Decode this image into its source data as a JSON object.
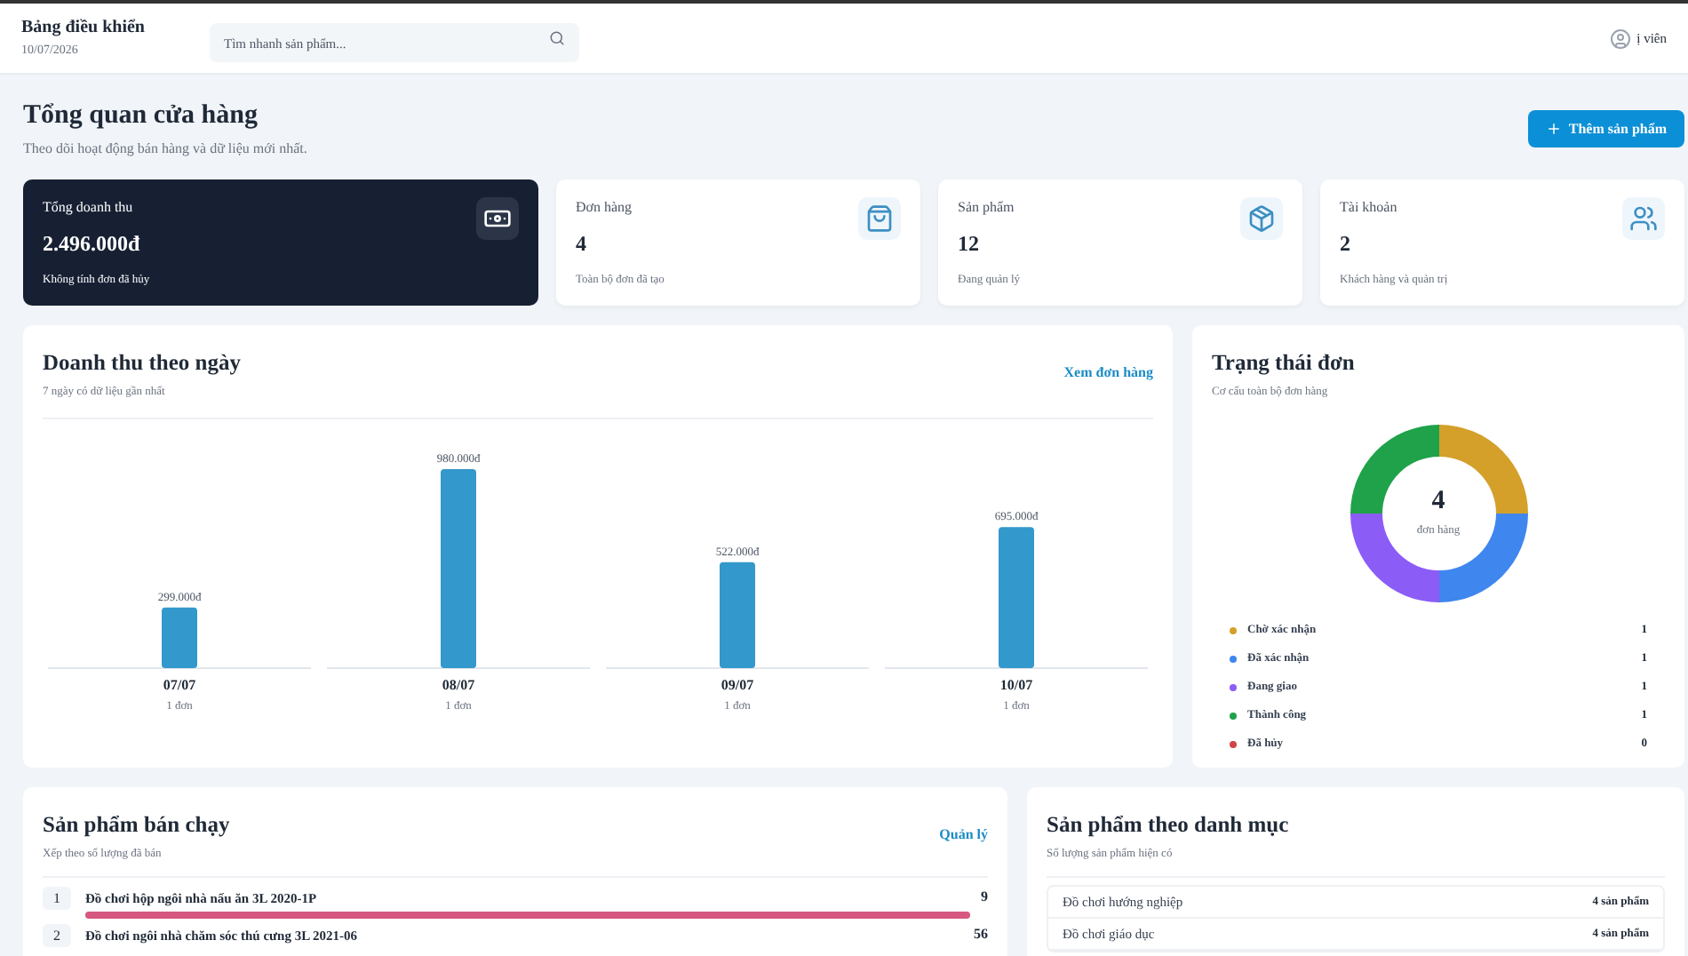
{
  "header": {
    "title": "Bảng điều khiển",
    "date": "10/07/2026",
    "search": {
      "placeholder": "Tìm nhanh sản phẩm..."
    },
    "user_label": "ị viên"
  },
  "overview": {
    "title": "Tổng quan cửa hàng",
    "subtitle": "Theo dõi hoạt động bán hàng và dữ liệu mới nhất.",
    "add_button": "Thêm sản phẩm"
  },
  "stats": [
    {
      "label": "Tổng doanh thu",
      "value": "2.496.000đ",
      "note": "Không tính đơn đã hủy",
      "kind": "money",
      "selected": true
    },
    {
      "label": "Đơn hàng",
      "value": "4",
      "note": "Toàn bộ đơn đã tạo",
      "kind": "orders",
      "selected": false
    },
    {
      "label": "Sản phẩm",
      "value": "12",
      "note": "Đang quản lý",
      "kind": "products",
      "selected": false
    },
    {
      "label": "Tài khoản",
      "value": "2",
      "note": "Khách hàng và quản trị",
      "kind": "accounts",
      "selected": false
    }
  ],
  "revenue": {
    "title": "Doanh thu theo ngày",
    "subtitle": "7 ngày có dữ liệu gần nhất",
    "link": "Xem đơn hàng",
    "day_notes": [
      "1 đơn",
      "1 đơn",
      "1 đơn",
      "1 đơn"
    ],
    "chart_data": {
      "type": "bar",
      "categories": [
        "07/07",
        "08/07",
        "09/07",
        "10/07"
      ],
      "values": [
        299000,
        980000,
        522000,
        695000
      ],
      "value_labels": [
        "299.000đ",
        "980.000đ",
        "522.000đ",
        "695.000đ"
      ]
    }
  },
  "order_status": {
    "title": "Trạng thái đơn",
    "subtitle": "Cơ cấu toàn bộ đơn hàng",
    "total": "4",
    "total_label": "đơn hàng",
    "chart_data": {
      "type": "donut",
      "values": [
        25,
        25,
        25,
        25,
        0
      ]
    },
    "legend": [
      {
        "label": "Chờ xác nhận",
        "count": "1",
        "color": "#d4a02a"
      },
      {
        "label": "Đã xác nhận",
        "count": "1",
        "color": "#3f86ef"
      },
      {
        "label": "Đang giao",
        "count": "1",
        "color": "#8b5cf6"
      },
      {
        "label": "Thành công",
        "count": "1",
        "color": "#1fa24a"
      },
      {
        "label": "Đã hủy",
        "count": "0",
        "color": "#d04545"
      }
    ]
  },
  "best_sellers": {
    "title": "Sản phẩm bán chạy",
    "subtitle": "Xếp theo số lượng đã bán",
    "link": "Quản lý",
    "items": [
      {
        "rank": "1",
        "name": "Đồ chơi hộp ngôi nhà nấu ăn 3L 2020-1P",
        "count": "9",
        "level": 1
      },
      {
        "rank": "2",
        "name": "Đồ chơi ngôi nhà chăm sóc thú cưng 3L 2021-06",
        "count": "56"
      }
    ]
  },
  "categories": {
    "title": "Sản phẩm theo danh mục",
    "subtitle": "Số lượng sản phẩm hiện có",
    "items": [
      {
        "name": "Đồ chơi hướng nghiệp",
        "count": "4 sản phẩm"
      },
      {
        "name": "Đồ chơi giáo dục",
        "count": "4 sản phẩm"
      }
    ]
  }
}
